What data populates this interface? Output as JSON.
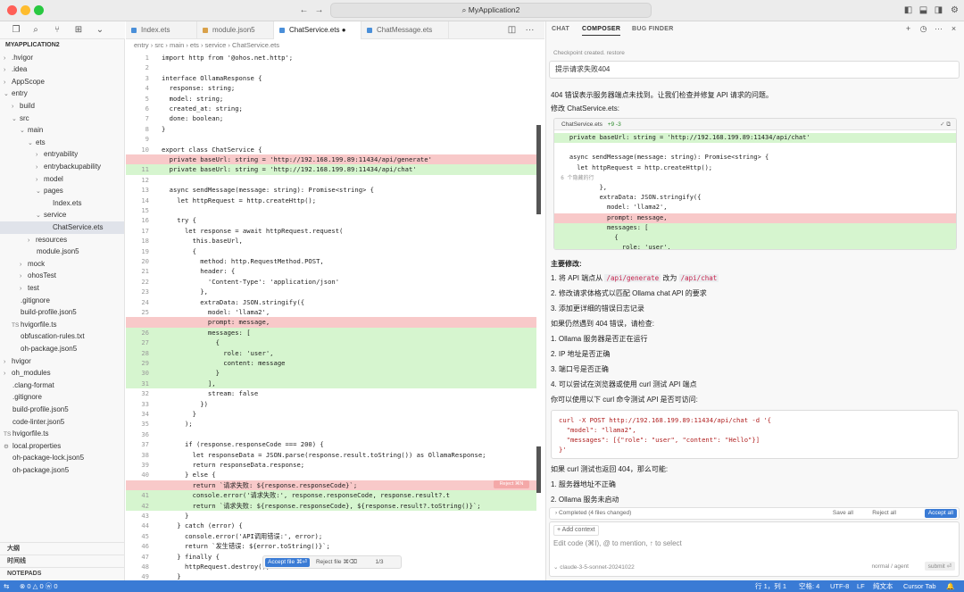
{
  "window_title": "MyApplication2",
  "colors": {
    "accent": "#3a7bd5",
    "deleted": "#f8c9c9",
    "added": "#d6f5cf"
  },
  "explorer": {
    "root": "MYAPPLICATION2",
    "items": [
      {
        "label": ".hvigor",
        "depth": 1,
        "type": "folder",
        "open": false
      },
      {
        "label": ".idea",
        "depth": 1,
        "type": "folder",
        "open": false
      },
      {
        "label": "AppScope",
        "depth": 1,
        "type": "folder",
        "open": false
      },
      {
        "label": "entry",
        "depth": 1,
        "type": "folder",
        "open": true
      },
      {
        "label": "build",
        "depth": 2,
        "type": "folder",
        "open": false
      },
      {
        "label": "src",
        "depth": 2,
        "type": "folder",
        "open": true
      },
      {
        "label": "main",
        "depth": 3,
        "type": "folder",
        "open": true
      },
      {
        "label": "ets",
        "depth": 4,
        "type": "folder",
        "open": true
      },
      {
        "label": "entryability",
        "depth": 5,
        "type": "folder",
        "open": false
      },
      {
        "label": "entrybackupability",
        "depth": 5,
        "type": "folder",
        "open": false
      },
      {
        "label": "model",
        "depth": 5,
        "type": "folder",
        "open": false
      },
      {
        "label": "pages",
        "depth": 5,
        "type": "folder",
        "open": true
      },
      {
        "label": "Index.ets",
        "depth": 6,
        "type": "file",
        "open": false
      },
      {
        "label": "service",
        "depth": 5,
        "type": "folder",
        "open": true
      },
      {
        "label": "ChatService.ets",
        "depth": 6,
        "type": "file",
        "open": false,
        "selected": true
      },
      {
        "label": "resources",
        "depth": 4,
        "type": "folder",
        "open": false
      },
      {
        "label": "module.json5",
        "depth": 4,
        "type": "file",
        "open": false
      },
      {
        "label": "mock",
        "depth": 3,
        "type": "folder",
        "open": false
      },
      {
        "label": "ohosTest",
        "depth": 3,
        "type": "folder",
        "open": false
      },
      {
        "label": "test",
        "depth": 3,
        "type": "folder",
        "open": false
      },
      {
        "label": ".gitignore",
        "depth": 2,
        "type": "file",
        "open": false
      },
      {
        "label": "build-profile.json5",
        "depth": 2,
        "type": "file",
        "open": false
      },
      {
        "label": "hvigorfile.ts",
        "depth": 2,
        "type": "ts",
        "open": false
      },
      {
        "label": "obfuscation-rules.txt",
        "depth": 2,
        "type": "file",
        "open": false
      },
      {
        "label": "oh-package.json5",
        "depth": 2,
        "type": "file",
        "open": false
      },
      {
        "label": "hvigor",
        "depth": 1,
        "type": "folder",
        "open": false
      },
      {
        "label": "oh_modules",
        "depth": 1,
        "type": "folder",
        "open": false
      },
      {
        "label": ".clang-format",
        "depth": 1,
        "type": "file",
        "open": false
      },
      {
        "label": ".gitignore",
        "depth": 1,
        "type": "file",
        "open": false
      },
      {
        "label": "build-profile.json5",
        "depth": 1,
        "type": "file",
        "open": false
      },
      {
        "label": "code-linter.json5",
        "depth": 1,
        "type": "file",
        "open": false
      },
      {
        "label": "hvigorfile.ts",
        "depth": 1,
        "type": "ts",
        "open": false
      },
      {
        "label": "local.properties",
        "depth": 1,
        "type": "gear",
        "open": false
      },
      {
        "label": "oh-package-lock.json5",
        "depth": 1,
        "type": "file",
        "open": false
      },
      {
        "label": "oh-package.json5",
        "depth": 1,
        "type": "file",
        "open": false
      }
    ],
    "sections": [
      "大纲",
      "时间线",
      "NOTEPADS"
    ]
  },
  "tabs": [
    {
      "label": "Index.ets",
      "color": "#4a8fd9"
    },
    {
      "label": "module.json5",
      "color": "#d9a14a"
    },
    {
      "label": "ChatService.ets",
      "color": "#4a8fd9",
      "active": true,
      "dirty": "●"
    },
    {
      "label": "ChatMessage.ets",
      "color": "#4a8fd9"
    }
  ],
  "breadcrumb": "entry  ›  src  ›  main  ›  ets  ›  service  ›  ChatService.ets",
  "code_lines": [
    {
      "n": "1",
      "t": "import http from '@ohos.net.http';",
      "k": ""
    },
    {
      "n": "2",
      "t": "",
      "k": ""
    },
    {
      "n": "3",
      "t": "interface OllamaResponse {",
      "k": ""
    },
    {
      "n": "4",
      "t": "  response: string;",
      "k": ""
    },
    {
      "n": "5",
      "t": "  model: string;",
      "k": ""
    },
    {
      "n": "6",
      "t": "  created_at: string;",
      "k": ""
    },
    {
      "n": "7",
      "t": "  done: boolean;",
      "k": ""
    },
    {
      "n": "8",
      "t": "}",
      "k": ""
    },
    {
      "n": "9",
      "t": "",
      "k": ""
    },
    {
      "n": "10",
      "t": "export class ChatService {",
      "k": ""
    },
    {
      "n": "",
      "t": "  private baseUrl: string = 'http://192.168.199.89:11434/api/generate'",
      "k": "del"
    },
    {
      "n": "11",
      "t": "  private baseUrl: string = 'http://192.168.199.89:11434/api/chat'",
      "k": "add"
    },
    {
      "n": "12",
      "t": "",
      "k": ""
    },
    {
      "n": "13",
      "t": "  async sendMessage(message: string): Promise<string> {",
      "k": ""
    },
    {
      "n": "14",
      "t": "    let httpRequest = http.createHttp();",
      "k": ""
    },
    {
      "n": "15",
      "t": "",
      "k": ""
    },
    {
      "n": "16",
      "t": "    try {",
      "k": ""
    },
    {
      "n": "17",
      "t": "      let response = await httpRequest.request(",
      "k": ""
    },
    {
      "n": "18",
      "t": "        this.baseUrl,",
      "k": ""
    },
    {
      "n": "19",
      "t": "        {",
      "k": ""
    },
    {
      "n": "20",
      "t": "          method: http.RequestMethod.POST,",
      "k": ""
    },
    {
      "n": "21",
      "t": "          header: {",
      "k": ""
    },
    {
      "n": "22",
      "t": "            'Content-Type': 'application/json'",
      "k": ""
    },
    {
      "n": "23",
      "t": "          },",
      "k": ""
    },
    {
      "n": "24",
      "t": "          extraData: JSON.stringify({",
      "k": ""
    },
    {
      "n": "25",
      "t": "            model: 'llama2',",
      "k": ""
    },
    {
      "n": "",
      "t": "            prompt: message,",
      "k": "del"
    },
    {
      "n": "26",
      "t": "            messages: [",
      "k": "add"
    },
    {
      "n": "27",
      "t": "              {",
      "k": "add"
    },
    {
      "n": "28",
      "t": "                role: 'user',",
      "k": "add"
    },
    {
      "n": "29",
      "t": "                content: message",
      "k": "add"
    },
    {
      "n": "30",
      "t": "              }",
      "k": "add"
    },
    {
      "n": "31",
      "t": "            ],",
      "k": "add"
    },
    {
      "n": "32",
      "t": "            stream: false",
      "k": ""
    },
    {
      "n": "33",
      "t": "          })",
      "k": ""
    },
    {
      "n": "34",
      "t": "        }",
      "k": ""
    },
    {
      "n": "35",
      "t": "      );",
      "k": ""
    },
    {
      "n": "36",
      "t": "",
      "k": ""
    },
    {
      "n": "37",
      "t": "      if (response.responseCode === 200) {",
      "k": ""
    },
    {
      "n": "38",
      "t": "        let responseData = JSON.parse(response.result.toString()) as OllamaResponse;",
      "k": ""
    },
    {
      "n": "39",
      "t": "        return responseData.response;",
      "k": ""
    },
    {
      "n": "40",
      "t": "      } else {",
      "k": ""
    },
    {
      "n": "",
      "t": "        return `请求失败: ${response.responseCode}`;",
      "k": "del"
    },
    {
      "n": "41",
      "t": "        console.error('请求失败:', response.responseCode, response.result?.t",
      "k": "add"
    },
    {
      "n": "42",
      "t": "        return `请求失败: ${response.responseCode}, ${response.result?.toString()}`;",
      "k": "add"
    },
    {
      "n": "43",
      "t": "      }",
      "k": ""
    },
    {
      "n": "44",
      "t": "    } catch (error) {",
      "k": ""
    },
    {
      "n": "45",
      "t": "      console.error('API调用错误:', error);",
      "k": ""
    },
    {
      "n": "46",
      "t": "      return `发生错误: ${error.toString()}`;",
      "k": ""
    },
    {
      "n": "47",
      "t": "    } finally {",
      "k": ""
    },
    {
      "n": "48",
      "t": "      httpRequest.destroy();",
      "k": ""
    },
    {
      "n": "49",
      "t": "    }",
      "k": ""
    },
    {
      "n": "50",
      "t": "  }",
      "k": ""
    }
  ],
  "reject_pill": "Reject ⌘N",
  "accept_bar": {
    "accept": "Accept file ⌘⏎",
    "reject": "Reject file ⌘⌫",
    "count": "1/3"
  },
  "panel": {
    "tabs": [
      "CHAT",
      "COMPOSER",
      "BUG FINDER"
    ],
    "checkpoint": "Checkpoint created. restore",
    "user_msg": "提示请求失败404",
    "intro": "404 错误表示服务器端点未找到。让我们检查并修复 API 请求的问题。",
    "fix_title": "修改 ChatService.ets:",
    "diff_file": "ChatService.ets",
    "diff_stats": "+9 -3",
    "diff_lines": [
      {
        "t": "    private baseUrl: string = 'http://192.168.199.89:11434/api/chat'",
        "k": "add"
      },
      {
        "t": "",
        "k": ""
      },
      {
        "t": "    async sendMessage(message: string): Promise<string> {",
        "k": ""
      },
      {
        "t": "      let httpRequest = http.createHttp();",
        "k": ""
      },
      {
        "t": "  6 个隐藏的行",
        "k": "hidden"
      },
      {
        "t": "            },",
        "k": ""
      },
      {
        "t": "            extraData: JSON.stringify({",
        "k": ""
      },
      {
        "t": "              model: 'llama2',",
        "k": ""
      },
      {
        "t": "              prompt: message,",
        "k": "del"
      },
      {
        "t": "              messages: [",
        "k": "add"
      },
      {
        "t": "                {",
        "k": "add"
      },
      {
        "t": "                  role: 'user',",
        "k": "add"
      }
    ],
    "summary_title": "主要修改:",
    "summary_items": [
      {
        "pre": "1. 将 API 端点从 ",
        "code1": "/api/generate",
        "mid": " 改为 ",
        "code2": "/api/chat"
      },
      {
        "pre": "2. 修改请求体格式以匹配 Ollama chat API 的要求",
        "code1": "",
        "mid": "",
        "code2": ""
      },
      {
        "pre": "3. 添加更详细的错误日志记录",
        "code1": "",
        "mid": "",
        "code2": ""
      }
    ],
    "check_title": "如果仍然遇到 404 错误，请检查:",
    "check_items": [
      "1. Ollama 服务器是否正在运行",
      "2. IP 地址是否正确",
      "3. 端口号是否正确",
      "4. 可以尝试在浏览器或使用 curl 测试 API 端点"
    ],
    "curl_intro": "你可以使用以下 curl 命令测试 API 是否可访问:",
    "curl_lines": [
      "curl -X POST http://192.168.199.89:11434/api/chat -d '{",
      "  \"model\": \"llama2\",",
      "  \"messages\": [{\"role\": \"user\", \"content\": \"Hello\"}]",
      "}'"
    ],
    "fail_title": "如果 curl 测试也返回 404，那么可能:",
    "fail_items": [
      "1. 服务器地址不正确",
      "2. Ollama 服务未启动"
    ],
    "completed": "Completed (4 files changed)",
    "save_all": "Save all",
    "reject_all": "Reject all",
    "accept_all": "Accept all",
    "add_context": "Add context",
    "composer_placeholder": "Edit code (⌘I), @ to mention, ↑ to select",
    "model": "claude-3-5-sonnet-20241022",
    "mode": "normal / agent",
    "submit": "submit ⏎"
  },
  "status": {
    "left": "⊗ 0 △ 0   ⓦ 0",
    "position": "行 1，列 1",
    "spaces": "空格: 4",
    "encoding": "UTF-8",
    "eol": "LF",
    "lang": "纯文本",
    "cursor_tab": "Cursor Tab"
  }
}
